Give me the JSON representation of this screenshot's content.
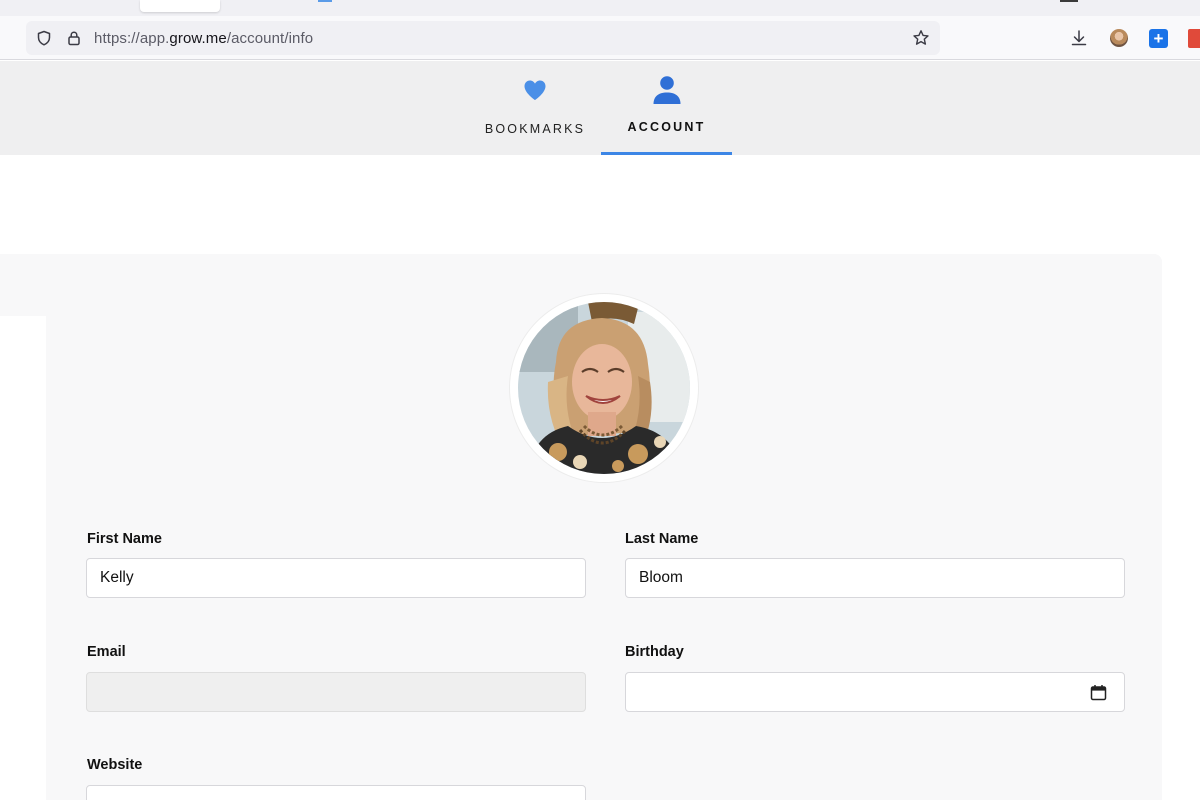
{
  "browser": {
    "url_scheme": "https://app.",
    "url_host": "grow.me",
    "url_path": "/account/info"
  },
  "nav": {
    "tabs": [
      {
        "label": "BOOKMARKS",
        "icon": "heart-icon",
        "active": false
      },
      {
        "label": "ACCOUNT",
        "icon": "user-icon",
        "active": true
      }
    ],
    "accent_color": "#3c86e6"
  },
  "profile": {
    "photo": "profile-photo"
  },
  "form": {
    "first_name": {
      "label": "First Name",
      "value": "Kelly"
    },
    "last_name": {
      "label": "Last Name",
      "value": "Bloom"
    },
    "email": {
      "label": "Email",
      "value": ""
    },
    "birthday": {
      "label": "Birthday",
      "value": "",
      "icon": "calendar-icon"
    },
    "website": {
      "label": "Website",
      "value": ""
    }
  }
}
